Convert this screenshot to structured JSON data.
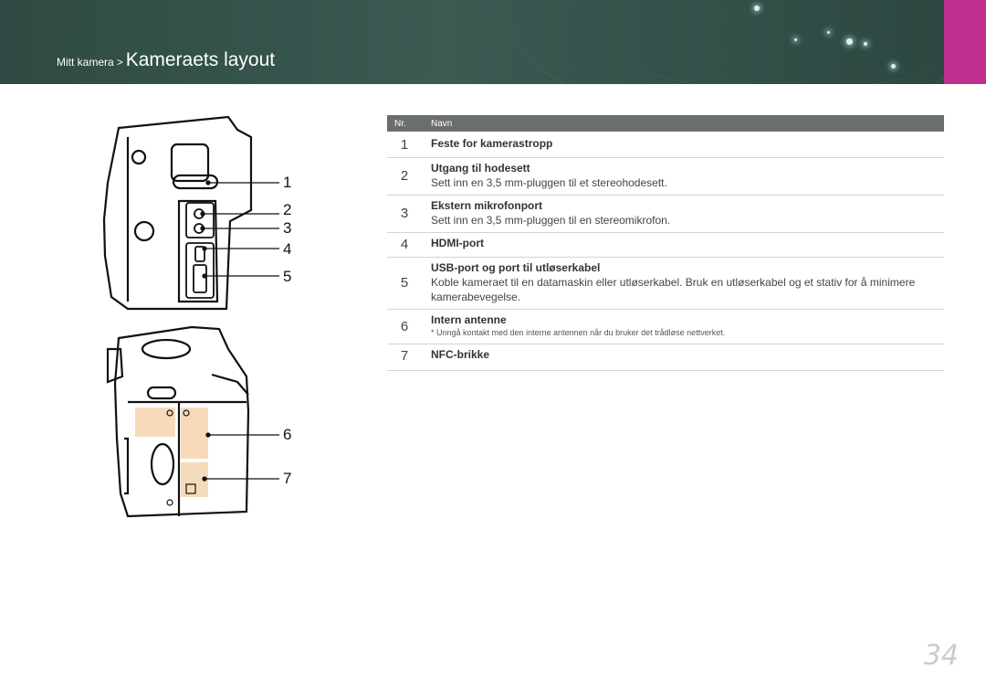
{
  "header": {
    "breadcrumb_parent": "Mitt kamera",
    "breadcrumb_separator": ">",
    "page_title": "Kameraets layout",
    "accent_color": "#c2308f",
    "background_color": "#33504a"
  },
  "figure": {
    "callouts": [
      "1",
      "2",
      "3",
      "4",
      "5",
      "6",
      "7"
    ]
  },
  "table": {
    "col_number": "Nr.",
    "col_name": "Navn",
    "rows": [
      {
        "number": "1",
        "name": "Feste for kamerastropp",
        "description": "",
        "note": ""
      },
      {
        "number": "2",
        "name": "Utgang til hodesett",
        "description": "Sett inn en 3,5 mm-pluggen til et stereohodesett.",
        "note": ""
      },
      {
        "number": "3",
        "name": "Ekstern mikrofonport",
        "description": "Sett inn en 3,5 mm-pluggen til en stereomikrofon.",
        "note": ""
      },
      {
        "number": "4",
        "name": "HDMI-port",
        "description": "",
        "note": ""
      },
      {
        "number": "5",
        "name": "USB-port og port til utløserkabel",
        "description": "Koble kameraet til en datamaskin eller utløserkabel. Bruk en utløserkabel og et stativ for å minimere kamerabevegelse.",
        "note": ""
      },
      {
        "number": "6",
        "name": "Intern antenne",
        "description": "",
        "note": "* Unngå kontakt med den interne antennen når du bruker det trådløse nettverket."
      },
      {
        "number": "7",
        "name": "NFC-brikke",
        "description": "",
        "note": ""
      }
    ]
  },
  "page_number": "34"
}
